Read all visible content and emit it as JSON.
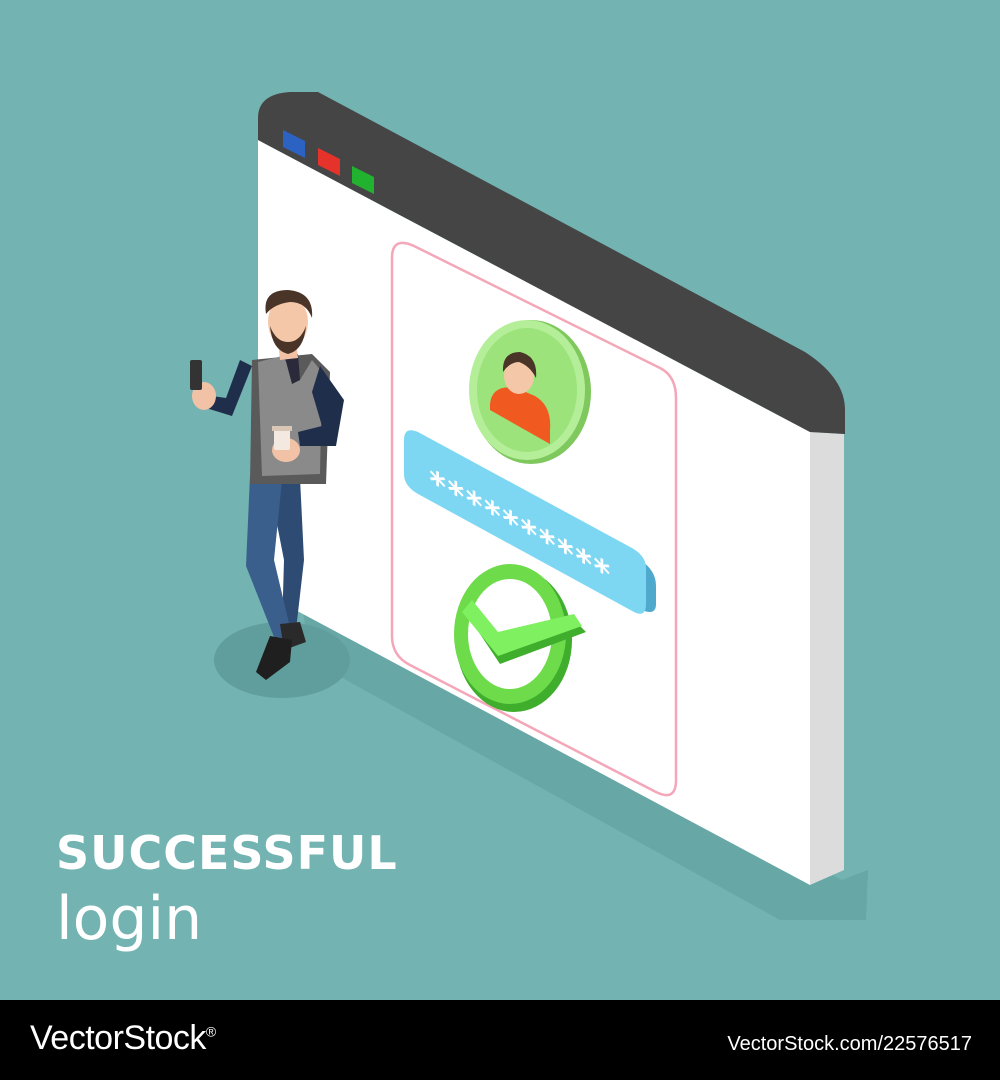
{
  "caption": {
    "title": "SUCCESSFUL",
    "subtitle": "login"
  },
  "login_card": {
    "password_mask": "**********",
    "status": "success"
  },
  "footer": {
    "brand": "VectorStock",
    "brand_mark": "®",
    "image_id": "VectorStock.com/22576517"
  },
  "colors": {
    "background": "#73b3b1",
    "window_bar": "#454545",
    "window_body": "#ffffff",
    "card_border": "#f3a7b9",
    "avatar_green": "#9be37a",
    "password_field": "#7dd7f3",
    "check_green": "#6ddb4a",
    "dot_blue": "#2c63c3",
    "dot_red": "#e5322b",
    "dot_green": "#21b32f"
  }
}
